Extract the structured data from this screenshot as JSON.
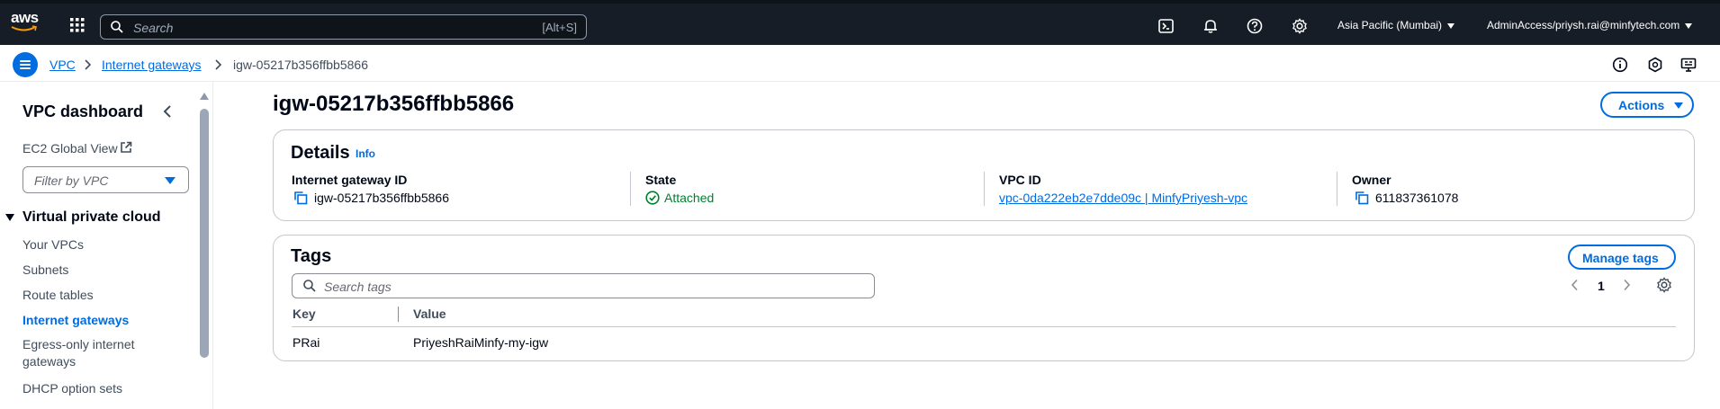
{
  "topnav": {
    "logo_text": "aws",
    "search_placeholder": "Search",
    "search_shortcut": "[Alt+S]",
    "region": "Asia Pacific (Mumbai)",
    "account": "AdminAccess/priysh.rai@minfytech.com",
    "icons": [
      "cloudshell-icon",
      "bell-icon",
      "help-icon",
      "settings-icon"
    ]
  },
  "breadcrumb": {
    "items": [
      "VPC",
      "Internet gateways",
      "igw-05217b356ffbb5866"
    ],
    "right_icons": [
      "info-icon",
      "feedback-icon",
      "display-icon"
    ]
  },
  "sidebar": {
    "title": "VPC dashboard",
    "ec2_global_view": "EC2 Global View",
    "filter_placeholder": "Filter by VPC",
    "section": "Virtual private cloud",
    "items": [
      {
        "label": "Your VPCs",
        "active": false
      },
      {
        "label": "Subnets",
        "active": false
      },
      {
        "label": "Route tables",
        "active": false
      },
      {
        "label": "Internet gateways",
        "active": true
      },
      {
        "label": "Egress-only internet gateways",
        "active": false
      },
      {
        "label": "DHCP option sets",
        "active": false
      }
    ]
  },
  "main": {
    "title": "igw-05217b356ffbb5866",
    "actions_label": "Actions",
    "details": {
      "title": "Details",
      "info": "Info",
      "fields": [
        {
          "label": "Internet gateway ID",
          "value": "igw-05217b356ffbb5866"
        },
        {
          "label": "State",
          "value": "Attached"
        },
        {
          "label": "VPC ID",
          "value": "vpc-0da222eb2e7dde09c | MinfyPriyesh-vpc"
        },
        {
          "label": "Owner",
          "value": "611837361078"
        }
      ]
    },
    "tags": {
      "title": "Tags",
      "manage_label": "Manage tags",
      "search_placeholder": "Search tags",
      "page": "1",
      "columns": [
        "Key",
        "Value"
      ],
      "rows": [
        {
          "key": "PRai",
          "value": "PriyeshRaiMinfy-my-igw"
        }
      ]
    }
  },
  "colors": {
    "nav_bg": "#161d26",
    "link": "#006ce0",
    "success": "#00802f",
    "border": "#c6c6cd"
  }
}
